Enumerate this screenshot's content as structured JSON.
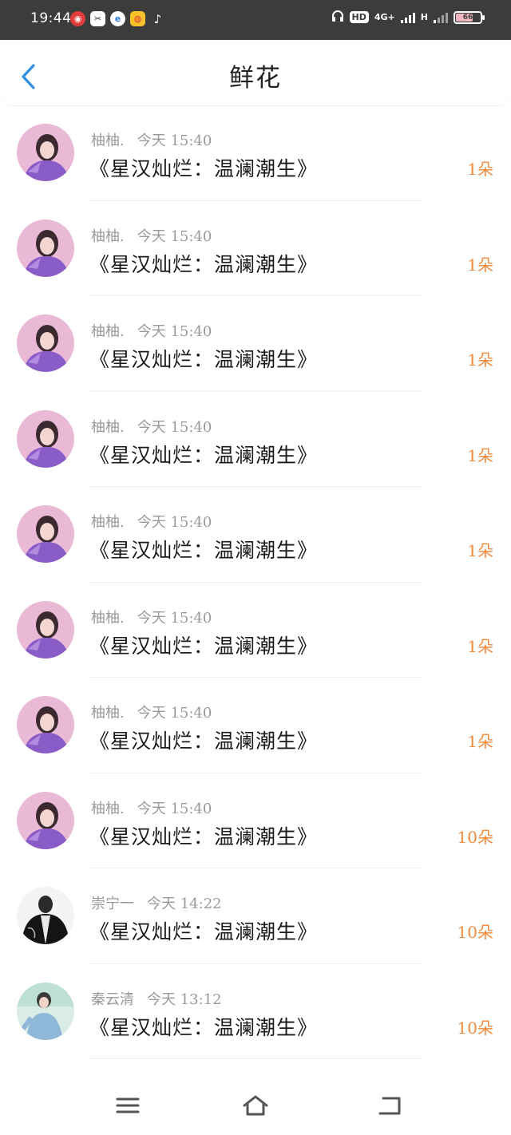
{
  "status_bar": {
    "time": "19:44",
    "network": "4G+",
    "network2": "H",
    "hd": "HD",
    "battery_percent": "66",
    "app_icons": [
      "netease-music-icon",
      "scissors-app-icon",
      "browser-icon",
      "weibo-icon",
      "tiktok-icon"
    ]
  },
  "header": {
    "title": "鲜花",
    "back_icon": "chevron-left-icon",
    "accent_color": "#2f8fe0"
  },
  "items": [
    {
      "name": "柚柚.",
      "time": "今天 15:40",
      "title": "《星汉灿烂：温澜潮生》",
      "amount": "1朵",
      "avatar": "avatar-purple-girl"
    },
    {
      "name": "柚柚.",
      "time": "今天 15:40",
      "title": "《星汉灿烂：温澜潮生》",
      "amount": "1朵",
      "avatar": "avatar-purple-girl"
    },
    {
      "name": "柚柚.",
      "time": "今天 15:40",
      "title": "《星汉灿烂：温澜潮生》",
      "amount": "1朵",
      "avatar": "avatar-purple-girl"
    },
    {
      "name": "柚柚.",
      "time": "今天 15:40",
      "title": "《星汉灿烂：温澜潮生》",
      "amount": "1朵",
      "avatar": "avatar-purple-girl"
    },
    {
      "name": "柚柚.",
      "time": "今天 15:40",
      "title": "《星汉灿烂：温澜潮生》",
      "amount": "1朵",
      "avatar": "avatar-purple-girl"
    },
    {
      "name": "柚柚.",
      "time": "今天 15:40",
      "title": "《星汉灿烂：温澜潮生》",
      "amount": "1朵",
      "avatar": "avatar-purple-girl"
    },
    {
      "name": "柚柚.",
      "time": "今天 15:40",
      "title": "《星汉灿烂：温澜潮生》",
      "amount": "1朵",
      "avatar": "avatar-purple-girl"
    },
    {
      "name": "柚柚.",
      "time": "今天 15:40",
      "title": "《星汉灿烂：温澜潮生》",
      "amount": "10朵",
      "avatar": "avatar-purple-girl"
    },
    {
      "name": "崇宁一",
      "time": "今天 14:22",
      "title": "《星汉灿烂：温澜潮生》",
      "amount": "10朵",
      "avatar": "avatar-black-robe"
    },
    {
      "name": "秦云清",
      "time": "今天 13:12",
      "title": "《星汉灿烂：温澜潮生》",
      "amount": "10朵",
      "avatar": "avatar-blue-outfit"
    }
  ],
  "amount_color": "#f08a3c",
  "nav": {
    "menu_icon": "menu-icon",
    "home_icon": "home-icon",
    "back_icon": "back-icon"
  }
}
